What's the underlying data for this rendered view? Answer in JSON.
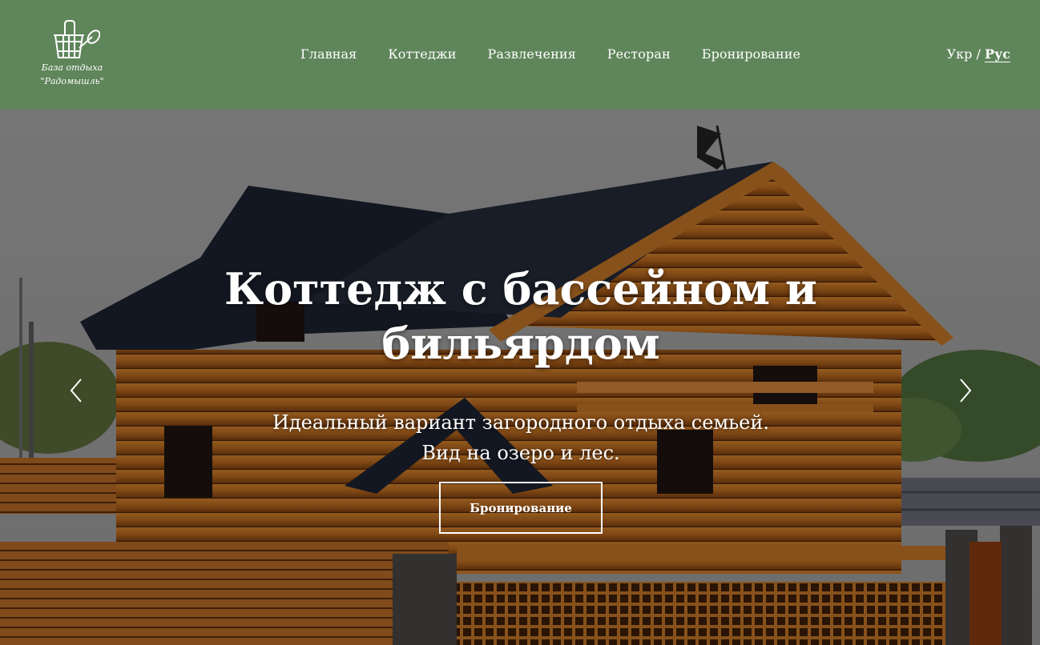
{
  "logo": {
    "line1": "База отдыха",
    "line2": "\"Радомышль\""
  },
  "nav": {
    "items": [
      {
        "label": "Главная"
      },
      {
        "label": "Коттеджи"
      },
      {
        "label": "Развлечения"
      },
      {
        "label": "Ресторан"
      },
      {
        "label": "Бронирование"
      }
    ]
  },
  "lang": {
    "ukr": "Укр",
    "separator": "/",
    "rus": "Рус",
    "active": "Рус"
  },
  "hero": {
    "title": "Коттедж с бассейном и бильярдом",
    "subtitle_line1": "Идеальный вариант загородного отдыха семьей.",
    "subtitle_line2": "Вид на озеро и лес.",
    "button_label": "Бронирование",
    "prev_icon": "chevron-left-icon",
    "next_icon": "chevron-right-icon"
  },
  "colors": {
    "header_bg": "#5f855b",
    "text": "#ffffff",
    "wood": "#b5651d",
    "roof": "#1c2230"
  }
}
